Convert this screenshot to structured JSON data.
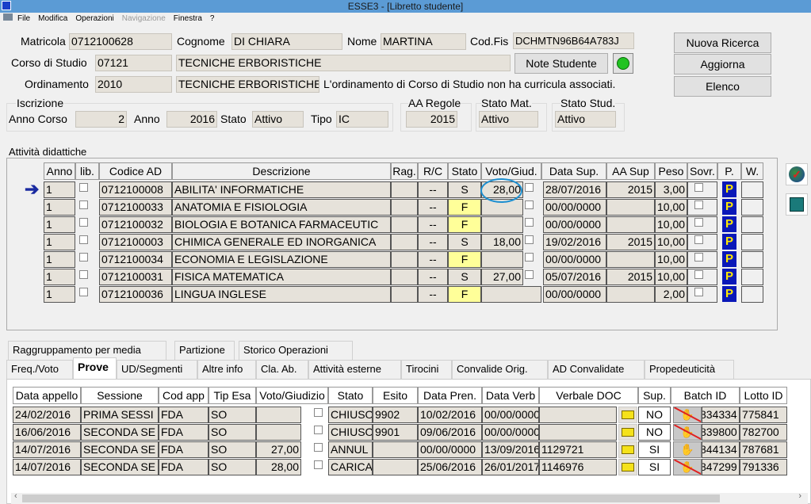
{
  "window": {
    "title": "ESSE3 - [Libretto studente]"
  },
  "menu": [
    "File",
    "Modifica",
    "Operazioni",
    "Navigazione",
    "Finestra",
    "?"
  ],
  "header": {
    "matricola_label": "Matricola",
    "matricola": "0712100628",
    "cognome_label": "Cognome",
    "cognome": "DI CHIARA",
    "nome_label": "Nome",
    "nome": "MARTINA",
    "codfis_label": "Cod.Fis",
    "codfis": "DCHMTN96B64A783J",
    "corso_label": "Corso di Studio",
    "corso_code": "07121",
    "corso_name": "TECNICHE ERBORISTICHE",
    "ordinamento_label": "Ordinamento",
    "ordinamento": "2010",
    "ordinamento_name": "TECNICHE ERBORISTICHE",
    "curricula_note": "L'ordinamento di Corso di Studio non ha curricula associati.",
    "iscrizione_label": "Iscrizione",
    "anno_corso_label": "Anno Corso",
    "anno_corso": "2",
    "anno_label": "Anno",
    "anno": "2016",
    "stato_label": "Stato",
    "stato": "Attivo",
    "tipo_label": "Tipo",
    "tipo": "IC",
    "aa_regole_label": "AA Regole",
    "aa_regole": "2015",
    "stato_mat_label": "Stato Mat.",
    "stato_mat": "Attivo",
    "stato_stud_label": "Stato Stud.",
    "stato_stud": "Attivo"
  },
  "buttons": {
    "nuova_ricerca": "Nuova Ricerca",
    "aggiorna": "Aggiorna",
    "elenco": "Elenco",
    "note_studente": "Note Studente"
  },
  "attivita": {
    "title": "Attività didattiche",
    "columns": [
      "Anno",
      "lib.",
      "Codice AD",
      "Descrizione",
      "Rag.",
      "R/C",
      "Stato",
      "Voto/Giud.",
      "Data Sup.",
      "AA Sup",
      "Peso",
      "Sovr.",
      "P.",
      "W."
    ],
    "rows": [
      {
        "anno": "1",
        "codice": "0712100008",
        "descrizione": "ABILITA' INFORMATICHE",
        "rc": "--",
        "stato": "S",
        "voto": "28,00",
        "data": "28/07/2016",
        "aa": "2015",
        "peso": "3,00",
        "p": "P"
      },
      {
        "anno": "1",
        "codice": "0712100033",
        "descrizione": "ANATOMIA E FISIOLOGIA",
        "rc": "--",
        "stato": "F",
        "voto": "",
        "data": "00/00/0000",
        "aa": "",
        "peso": "10,00",
        "p": "P"
      },
      {
        "anno": "1",
        "codice": "0712100032",
        "descrizione": "BIOLOGIA E BOTANICA FARMACEUTIC",
        "rc": "--",
        "stato": "F",
        "voto": "",
        "data": "00/00/0000",
        "aa": "",
        "peso": "10,00",
        "p": "P"
      },
      {
        "anno": "1",
        "codice": "0712100003",
        "descrizione": "CHIMICA GENERALE ED INORGANICA",
        "rc": "--",
        "stato": "S",
        "voto": "18,00",
        "data": "19/02/2016",
        "aa": "2015",
        "peso": "10,00",
        "p": "P"
      },
      {
        "anno": "1",
        "codice": "0712100034",
        "descrizione": "ECONOMIA E LEGISLAZIONE",
        "rc": "--",
        "stato": "F",
        "voto": "",
        "data": "00/00/0000",
        "aa": "",
        "peso": "10,00",
        "p": "P"
      },
      {
        "anno": "1",
        "codice": "0712100031",
        "descrizione": "FISICA MATEMATICA",
        "rc": "--",
        "stato": "S",
        "voto": "27,00",
        "data": "05/07/2016",
        "aa": "2015",
        "peso": "10,00",
        "p": "P"
      },
      {
        "anno": "1",
        "codice": "0712100036",
        "descrizione": "LINGUA INGLESE",
        "rc": "--",
        "stato": "F",
        "voto": "",
        "data": "00/00/0000",
        "aa": "",
        "peso": "2,00",
        "p": "P"
      }
    ]
  },
  "tabs_row1": [
    "Raggruppamento per media",
    "Partizione",
    "Storico Operazioni"
  ],
  "tabs_row2": [
    "Freq./Voto",
    "Prove",
    "UD/Segmenti",
    "Altre info",
    "Cla. Ab.",
    "Attività esterne",
    "Tirocini",
    "Convalide Orig.",
    "AD Convalidate",
    "Propedeuticità"
  ],
  "active_tab": "Prove",
  "prove": {
    "columns": [
      "Data appello",
      "Sessione",
      "Cod app",
      "Tip Esa",
      "Voto/Giudizio",
      "Stato",
      "Esito",
      "Data Pren.",
      "Data Verb",
      "Verbale DOC",
      "Sup.",
      "Batch ID",
      "Lotto ID"
    ],
    "rows": [
      {
        "data": "24/02/2016",
        "sessione": "PRIMA SESSI",
        "cod": "FDA",
        "tip": "SO",
        "voto": "",
        "stato": "CHIUSO",
        "esito": "9902",
        "pren": "10/02/2016",
        "verb": "00/00/0000",
        "doc": "",
        "sup": "NO",
        "batch_disabled": true,
        "batch": "834334",
        "lotto": "775841"
      },
      {
        "data": "16/06/2016",
        "sessione": "SECONDA SE",
        "cod": "FDA",
        "tip": "SO",
        "voto": "",
        "stato": "CHIUSO",
        "esito": "9901",
        "pren": "09/06/2016",
        "verb": "00/00/0000",
        "doc": "",
        "sup": "NO",
        "batch_disabled": true,
        "batch": "839800",
        "lotto": "782700"
      },
      {
        "data": "14/07/2016",
        "sessione": "SECONDA SE",
        "cod": "FDA",
        "tip": "SO",
        "voto": "27,00",
        "stato": "ANNUL",
        "esito": "",
        "pren": "00/00/0000",
        "verb": "13/09/2016",
        "doc": "1129721",
        "sup": "SI",
        "batch_disabled": false,
        "batch": "844134",
        "lotto": "787681"
      },
      {
        "data": "14/07/2016",
        "sessione": "SECONDA SE",
        "cod": "FDA",
        "tip": "SO",
        "voto": "28,00",
        "stato": "CARICA",
        "esito": "",
        "pren": "25/06/2016",
        "verb": "26/01/2017",
        "doc": "1146976",
        "sup": "SI",
        "batch_disabled": true,
        "batch": "847299",
        "lotto": "791336"
      }
    ]
  },
  "colors": {
    "titlebar": "#5b9bd5",
    "highlight_circle": "#1e8fd0",
    "yellow_stato": "#ffff99",
    "p_button": "#0a18b8"
  }
}
